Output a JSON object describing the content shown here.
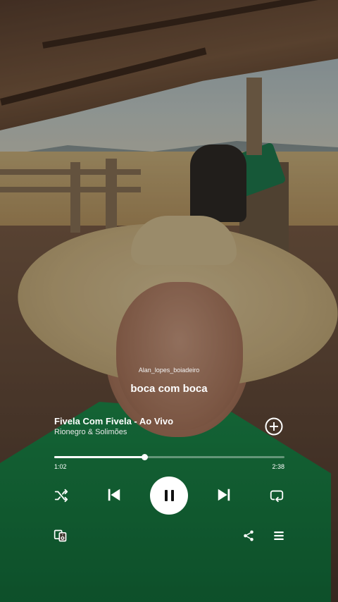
{
  "lyrics": {
    "author": "Alan_lopes_boiadeiro",
    "line": "boca com boca"
  },
  "track": {
    "title": "Fivela Com Fivela - Ao Vivo",
    "artist": "Rionegro & Solimões"
  },
  "playback": {
    "elapsed": "1:02",
    "total": "2:38",
    "progress_fraction": 0.39,
    "state": "playing"
  },
  "controls": {
    "icons": [
      "shuffle-icon",
      "previous-icon",
      "pause-icon",
      "next-icon",
      "repeat-icon",
      "device-icon",
      "share-icon",
      "queue-icon",
      "add-icon"
    ]
  },
  "colors": {
    "accent": "#ffffff",
    "play_button_bg": "#ffffff",
    "shirt_green": "#1c8a4a"
  }
}
